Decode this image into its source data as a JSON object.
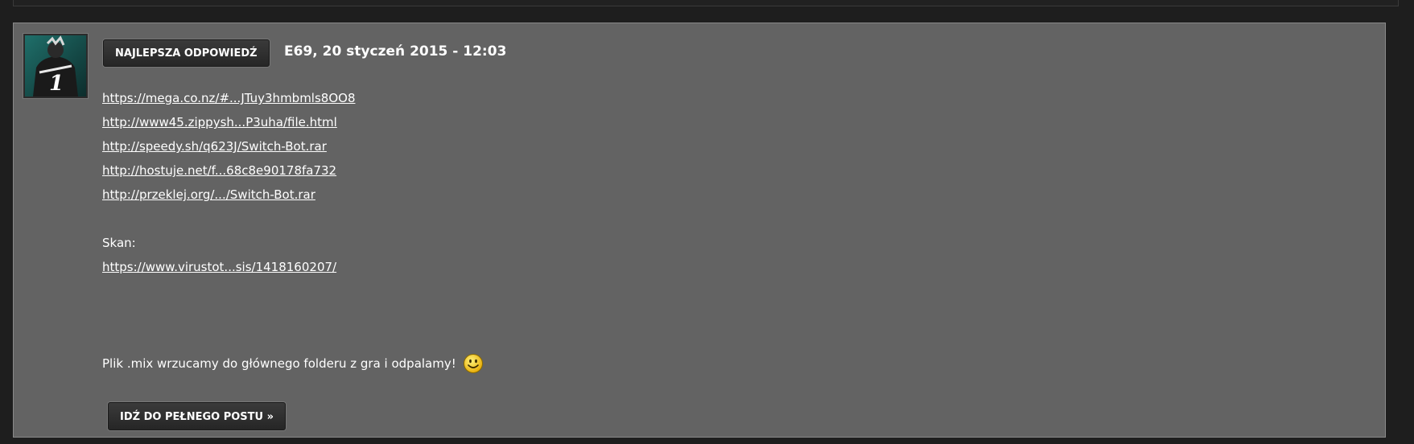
{
  "post": {
    "badge_label": "NAJLEPSZA ODPOWIEDŹ",
    "meta": "E69, 20 styczeń 2015 - 12:03",
    "links": [
      "https://mega.co.nz/#...JTuy3hmbmls8OO8",
      "http://www45.zippysh...P3uha/file.html",
      "http://speedy.sh/q623J/Switch-Bot.rar",
      "http://hostuje.net/f...68c8e90178fa732",
      "http://przeklej.org/.../Switch-Bot.rar"
    ],
    "scan_label": "Skan:",
    "scan_link": "https://www.virustot...sis/1418160207/",
    "closing_text": "Plik .mix wrzucamy do głównego folderu z gra i odpalamy!",
    "full_post_button_label": "IDŹ DO PEŁNEGO POSTU »"
  },
  "icons": {
    "avatar": "avatar-image",
    "smiley": "smiley-icon"
  },
  "colors": {
    "page_background": "#1e1e1e",
    "card_background": "#636363",
    "button_background": "#2b2b2b",
    "text": "#ffffff",
    "smiley_fill": "#f5c518"
  }
}
